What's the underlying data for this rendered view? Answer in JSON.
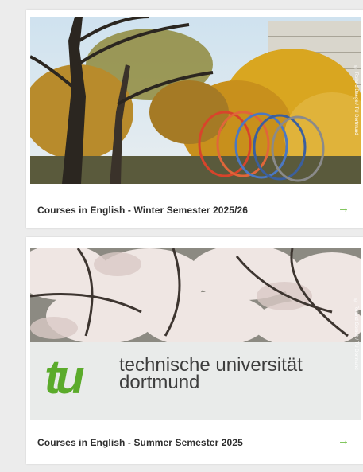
{
  "cards": [
    {
      "title": "Courses in English - Winter Semester 2025/26",
      "arrow": "→",
      "photo_credit": "© Roland Baege / TU Dortmund"
    },
    {
      "title": "Courses in English - Summer Semester 2025",
      "arrow": "→",
      "photo_credit": "© Roland Gorsch / TU Dortmund",
      "sign": {
        "logo": "tu",
        "name_line1": "technische universität",
        "name_line2": "dortmund"
      }
    }
  ],
  "colors": {
    "accent_arrow": "#5cb52d",
    "logo_green": "#5bab2b"
  },
  "icons": {
    "card_arrow": "arrow-right-icon"
  }
}
